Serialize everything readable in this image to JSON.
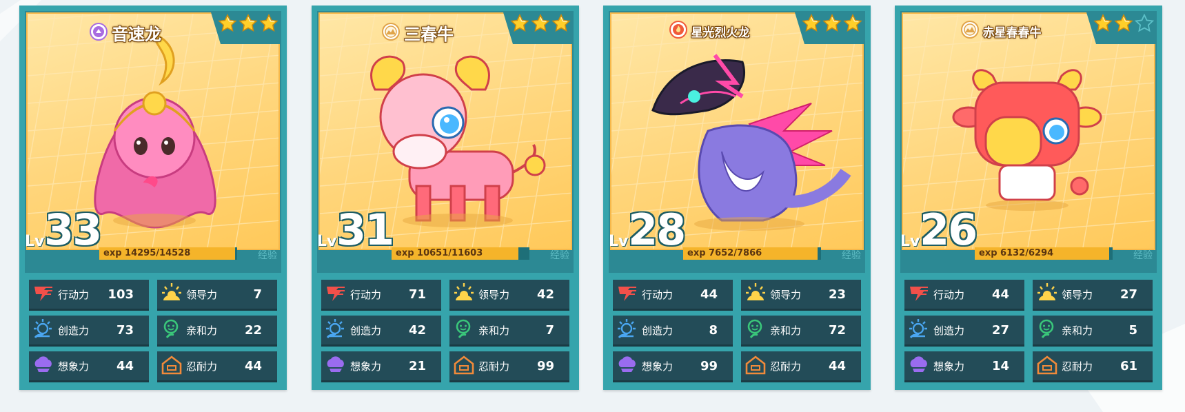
{
  "cards": [
    {
      "name": "音速龙",
      "element_icon": "sound-element-icon",
      "element_color": "#a86ce0",
      "stars_filled": 3,
      "stars_total": 3,
      "level": "33",
      "lv_label": "Lv",
      "exp_prefix": "exp",
      "exp_text": "14295/14528",
      "exp_ratio": 0.984,
      "exp_tag": "经验",
      "stats": [
        {
          "label": "行动力",
          "value": "103",
          "icon": "action-icon"
        },
        {
          "label": "领导力",
          "value": "7",
          "icon": "leadership-icon"
        },
        {
          "label": "创造力",
          "value": "73",
          "icon": "creativity-icon"
        },
        {
          "label": "亲和力",
          "value": "22",
          "icon": "affinity-icon"
        },
        {
          "label": "想象力",
          "value": "44",
          "icon": "imagination-icon"
        },
        {
          "label": "忍耐力",
          "value": "44",
          "icon": "endurance-icon"
        }
      ]
    },
    {
      "name": "三春牛",
      "element_icon": "earth-element-icon",
      "element_color": "#e0a44a",
      "stars_filled": 3,
      "stars_total": 3,
      "level": "31",
      "lv_label": "Lv",
      "exp_prefix": "exp",
      "exp_text": "10651/11603",
      "exp_ratio": 0.918,
      "exp_tag": "经验",
      "stats": [
        {
          "label": "行动力",
          "value": "71",
          "icon": "action-icon"
        },
        {
          "label": "领导力",
          "value": "42",
          "icon": "leadership-icon"
        },
        {
          "label": "创造力",
          "value": "42",
          "icon": "creativity-icon"
        },
        {
          "label": "亲和力",
          "value": "7",
          "icon": "affinity-icon"
        },
        {
          "label": "想象力",
          "value": "21",
          "icon": "imagination-icon"
        },
        {
          "label": "忍耐力",
          "value": "99",
          "icon": "endurance-icon"
        }
      ]
    },
    {
      "name": "星光烈火龙",
      "element_icon": "fire-element-icon",
      "element_color": "#f05a3a",
      "stars_filled": 3,
      "stars_total": 3,
      "level": "28",
      "lv_label": "Lv",
      "exp_prefix": "exp",
      "exp_text": "7652/7866",
      "exp_ratio": 0.973,
      "exp_tag": "经验",
      "stats": [
        {
          "label": "行动力",
          "value": "44",
          "icon": "action-icon"
        },
        {
          "label": "领导力",
          "value": "23",
          "icon": "leadership-icon"
        },
        {
          "label": "创造力",
          "value": "8",
          "icon": "creativity-icon"
        },
        {
          "label": "亲和力",
          "value": "72",
          "icon": "affinity-icon"
        },
        {
          "label": "想象力",
          "value": "99",
          "icon": "imagination-icon"
        },
        {
          "label": "忍耐力",
          "value": "44",
          "icon": "endurance-icon"
        }
      ]
    },
    {
      "name": "赤星春春牛",
      "element_icon": "earth-element-icon",
      "element_color": "#e0a44a",
      "stars_filled": 2,
      "stars_total": 3,
      "level": "26",
      "lv_label": "Lv",
      "exp_prefix": "exp",
      "exp_text": "6132/6294",
      "exp_ratio": 0.974,
      "exp_tag": "经验",
      "stats": [
        {
          "label": "行动力",
          "value": "44",
          "icon": "action-icon"
        },
        {
          "label": "领导力",
          "value": "27",
          "icon": "leadership-icon"
        },
        {
          "label": "创造力",
          "value": "27",
          "icon": "creativity-icon"
        },
        {
          "label": "亲和力",
          "value": "5",
          "icon": "affinity-icon"
        },
        {
          "label": "想象力",
          "value": "14",
          "icon": "imagination-icon"
        },
        {
          "label": "忍耐力",
          "value": "61",
          "icon": "endurance-icon"
        }
      ]
    }
  ]
}
